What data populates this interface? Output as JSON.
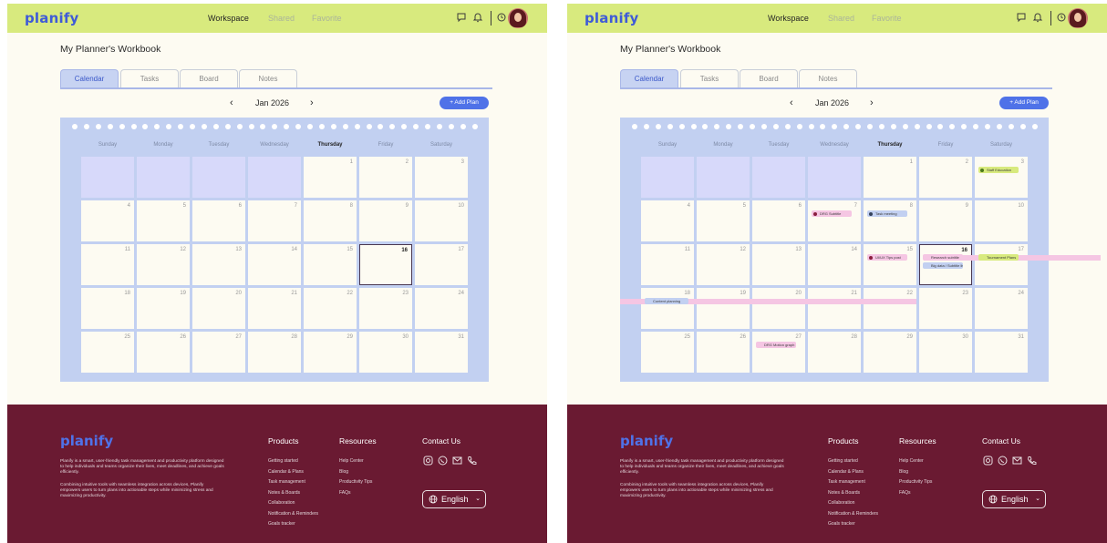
{
  "app": {
    "logo": "planify",
    "nav": [
      "Workspace",
      "Shared",
      "Favorite"
    ],
    "page_title": "My Planner's Workbook",
    "tabs": [
      "Calendar",
      "Tasks",
      "Board",
      "Notes"
    ],
    "month": "Jan 2026",
    "prev": "‹",
    "next": "›",
    "add_plan": "+ Add Plan",
    "weekdays": [
      "Sunday",
      "Monday",
      "Tuesday",
      "Wednesday",
      "Thursday",
      "Friday",
      "Saturday"
    ],
    "today": 16,
    "days_in_month": 31,
    "first_weekday": 4
  },
  "events": [
    {
      "day": 3,
      "label": "Staff Education",
      "color": "#d8ea7e",
      "dot": "#4b7a1b",
      "frame": "right"
    },
    {
      "day": 7,
      "label": "DRG Subtitle",
      "color": "#f5c6e3",
      "dot": "#8b1f3f",
      "frame": "right"
    },
    {
      "day": 8,
      "label": "Task meeting",
      "color": "#c2d0f1",
      "dot": "#34425c",
      "frame": "right"
    },
    {
      "day": 15,
      "label": "UI/UX Tips post",
      "color": "#f5c6e3",
      "dot": "#8b1f3f",
      "frame": "right"
    },
    {
      "day": 16,
      "label": "Research subtitle",
      "color": "#f5c6e3",
      "dot": "#f5c6e3",
      "frame": "right"
    },
    {
      "day": 16,
      "label": "Big data / Subtitle list",
      "color": "#c2d0f1",
      "dot": "#c2d0f1",
      "frame": "right"
    },
    {
      "day": 17,
      "label": "Tournament Plans",
      "color": "#d8ea7e",
      "dot": "#d8ea7e",
      "frame": "right"
    },
    {
      "day": 18,
      "label": "Content planning",
      "color": "#c2d0f1",
      "dot": "#c2d0f1",
      "frame": "right"
    },
    {
      "day": 27,
      "label": "DRG Motion graph",
      "color": "#f5c6e3",
      "dot": "#f5c6e3",
      "frame": "right"
    }
  ],
  "footer": {
    "logo": "planify",
    "description": "Planify is a smart, user-friendly task management and productivity platform designed to help individuals and teams organize their lives, meet deadlines, and achieve goals efficiently.",
    "description2": "Combining intuitive tools with seamless integration across devices, Planify empowers users to turn plans into actionable steps while minimizing stress and maximizing productivity.",
    "products_title": "Products",
    "products": [
      "Getting started",
      "Calendar & Plans",
      "Task management",
      "Notes & Boards",
      "Collaboration",
      "Notification & Reminders",
      "Goals tracker"
    ],
    "resources_title": "Resources",
    "resources": [
      "Help Center",
      "Blog",
      "Productivity Tips",
      "FAQs"
    ],
    "contact_title": "Contact Us",
    "language": "English"
  },
  "colors": {
    "topbar": "#d8ea7e",
    "accent": "#4f72e8",
    "calendar_bg": "#c2d0f1",
    "footer_bg": "#6a1a32"
  }
}
